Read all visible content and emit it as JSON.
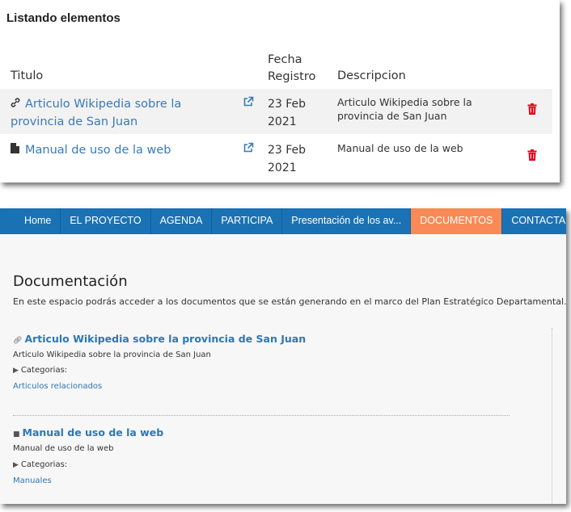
{
  "admin": {
    "title": "Listando elementos",
    "columns": {
      "titulo": "Titulo",
      "fecha": "Fecha\nRegistro",
      "descripcion": "Descripcion"
    },
    "rows": [
      {
        "icon": "link-icon",
        "title": "Articulo Wikipedia sobre la provincia de San Juan",
        "date": "23 Feb 2021",
        "description": "Articulo Wikipedia sobre la provincia de San Juan"
      },
      {
        "icon": "file-icon",
        "title": "Manual de uso de la web",
        "date": "23 Feb 2021",
        "description": "Manual de uso de la web"
      }
    ]
  },
  "site": {
    "nav": [
      "Home",
      "EL PROYECTO",
      "AGENDA",
      "PARTICIPA",
      "Presentación de los av...",
      "DOCUMENTOS",
      "CONTACTA"
    ],
    "active_nav": "DOCUMENTOS",
    "page_title": "Documentación",
    "intro": "En este espacio podrás acceder a los documentos que se están generando en el marco del Plan Estratégico Departamental.",
    "entries": [
      {
        "icon": "link-icon",
        "title": "Articulo Wikipedia sobre la provincia de San Juan",
        "description": "Articulo Wikipedia sobre la provincia de San Juan",
        "categories_label": "Categorias:",
        "category": "Articulos relacionados"
      },
      {
        "icon": "file-icon",
        "title": "Manual de uso de la web",
        "description": "Manual de uso de la web",
        "categories_label": "Categorias:",
        "category": "Manuales"
      }
    ]
  },
  "colors": {
    "link": "#3a7ab8",
    "nav": "#1a72b4",
    "nav_active": "#f98a55",
    "danger": "#e0001b"
  }
}
